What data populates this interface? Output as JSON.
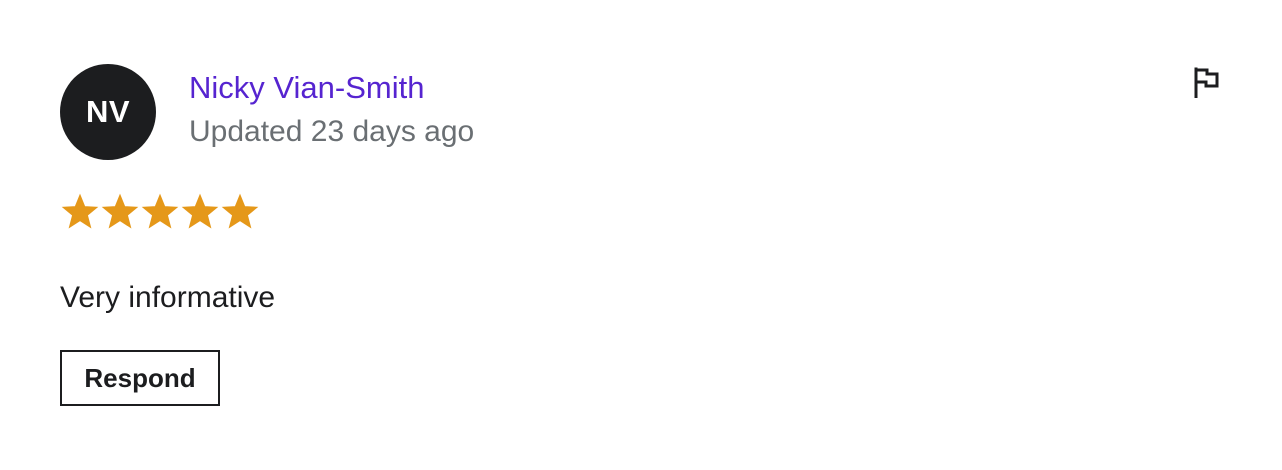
{
  "review": {
    "avatar_initials": "NV",
    "author_name": "Nicky Vian-Smith",
    "updated_text": "Updated 23 days ago",
    "rating": 5,
    "rating_max": 5,
    "comment": "Very informative",
    "respond_label": "Respond",
    "flag_icon": "flag-icon"
  },
  "colors": {
    "author_link": "#5624d0",
    "star_filled": "#e59819",
    "avatar_bg": "#1c1d1f",
    "muted_text": "#6a6f73"
  }
}
